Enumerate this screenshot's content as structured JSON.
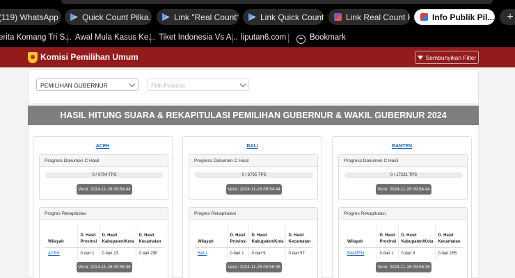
{
  "browser": {
    "tabs": [
      {
        "title": "(119) WhatsApp",
        "icon": "whatsapp-icon",
        "active": false
      },
      {
        "title": "Quick Count Pilka...",
        "icon": "arrow-icon",
        "active": false
      },
      {
        "title": "Link \"Real Count\" ...",
        "icon": "arrow-icon",
        "active": false
      },
      {
        "title": "Link Quick Count ...",
        "icon": "arrow-icon",
        "active": false
      },
      {
        "title": "Link Real Count Pil...",
        "icon": "site-icon",
        "active": false
      },
      {
        "title": "Info Publik Pil...",
        "icon": "kpu-icon",
        "active": true
      }
    ],
    "close_glyph": "✕",
    "new_tab_glyph": "+",
    "bookmarks": [
      "erita Komang Tri S...",
      "Awal Mula Kasus Ke...",
      "Tiket Indonesia Vs A...",
      "liputan6.com",
      "Bookmark"
    ]
  },
  "header": {
    "brand": "Komisi Pemilihan Umum",
    "filter_button": "Sembunyikan Filter"
  },
  "filters": {
    "election_type": "PEMILIHAN GUBERNUR",
    "province_placeholder": "Pilih Provinsi"
  },
  "main": {
    "title": "HASIL HITUNG SUARA & REKAPITULASI PEMILIHAN GUBERNUR & WAKIL GUBERNUR 2024",
    "c_hasil_heading": "Progress Dokumen C Hasil",
    "rekap_heading": "Progres Rekapitulasi",
    "table_headers": [
      "Wilayah",
      "D. Hasil Provinsi",
      "D. Hasil Kabupaten/Kota",
      "D. Hasil Kecamatan"
    ],
    "provinces": [
      {
        "name": "ACEH",
        "progress_text": "0 / 9704 TPS",
        "progress_fraction": 0,
        "versi_c": "Versi: 2024-11-26 09:54:44",
        "row": [
          "ACEH",
          "0 dari 1",
          "0 dari 23",
          "0 dari 290"
        ],
        "versi_rekap": "Versi: 2024-11-26 09:56:36"
      },
      {
        "name": "BALI",
        "progress_text": "0 / 6795 TPS",
        "progress_fraction": 0,
        "versi_c": "Versi: 2024-11-26 09:54:44",
        "row": [
          "BALI",
          "0 dari 1",
          "0 dari 9",
          "0 dari 57"
        ],
        "versi_rekap": "Versi: 2024-11-26 09:56:36"
      },
      {
        "name": "BANTEN",
        "progress_text": "0 / 17231 TPS",
        "progress_fraction": 0,
        "versi_c": "Versi: 2024-11-26 09:54:44",
        "row": [
          "BANTEN",
          "0 dari 1",
          "0 dari 8",
          "0 dari 155"
        ],
        "versi_rekap": "Versi: 2024-11-26 09:56:36"
      }
    ]
  }
}
